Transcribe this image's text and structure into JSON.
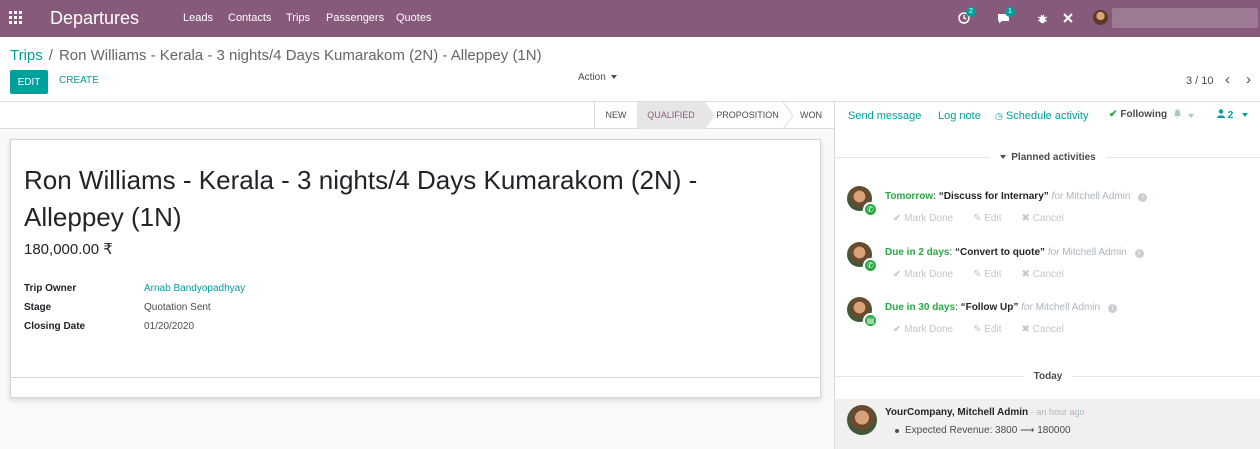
{
  "navbar": {
    "app_title": "Departures",
    "menu": [
      "Leads",
      "Contacts",
      "Trips",
      "Passengers",
      "Quotes"
    ],
    "activity_badge": "2",
    "message_badge": "1"
  },
  "breadcrumb": {
    "parent": "Trips",
    "current": "Ron Williams - Kerala - 3 nights/4 Days Kumarakom (2N) - Alleppey (1N)"
  },
  "buttons": {
    "edit": "EDIT",
    "create": "CREATE",
    "action": "Action"
  },
  "pager": {
    "value": "3 / 10",
    "prev": "‹",
    "next": "›"
  },
  "statusbar": {
    "stages": [
      "NEW",
      "QUALIFIED",
      "PROPOSITION",
      "WON"
    ],
    "active": "QUALIFIED"
  },
  "record": {
    "title": "Ron Williams - Kerala - 3 nights/4 Days Kumarakom (2N) - Alleppey (1N)",
    "revenue": "180,000.00 ₹",
    "fields": [
      {
        "label": "Trip Owner",
        "value": "Arnab Bandyopadhyay"
      },
      {
        "label": "Stage",
        "value": "Quotation Sent"
      },
      {
        "label": "Closing Date",
        "value": "01/20/2020"
      }
    ]
  },
  "chatter": {
    "send_message": "Send message",
    "log_note": "Log note",
    "schedule_activity": "Schedule activity",
    "following": "Following",
    "followers_count": "2",
    "planned_label": "Planned activities",
    "today_label": "Today",
    "activities": [
      {
        "when": "Tomorrow",
        "summary": "“Discuss for Internary”",
        "for": "for",
        "user": "Mitchell Admin",
        "type_icon": "phone-icon"
      },
      {
        "when": "Due in 2 days",
        "summary": "“Convert to quote”",
        "for": "for",
        "user": "Mitchell Admin",
        "type_icon": "phone-icon"
      },
      {
        "when": "Due in 30 days",
        "summary": "“Follow Up”",
        "for": "for",
        "user": "Mitchell Admin",
        "type_icon": "document-icon"
      }
    ],
    "activity_actions": {
      "mark_done": "Mark Done",
      "edit": "Edit",
      "cancel": "Cancel"
    },
    "message": {
      "author": "YourCompany, Mitchell Admin",
      "time": "- an hour ago",
      "change": "Expected Revenue: 3800 ⟶ 180000"
    }
  },
  "colors": {
    "navbar": "#875a7b",
    "accent": "#00a09d",
    "success": "#28a745"
  }
}
